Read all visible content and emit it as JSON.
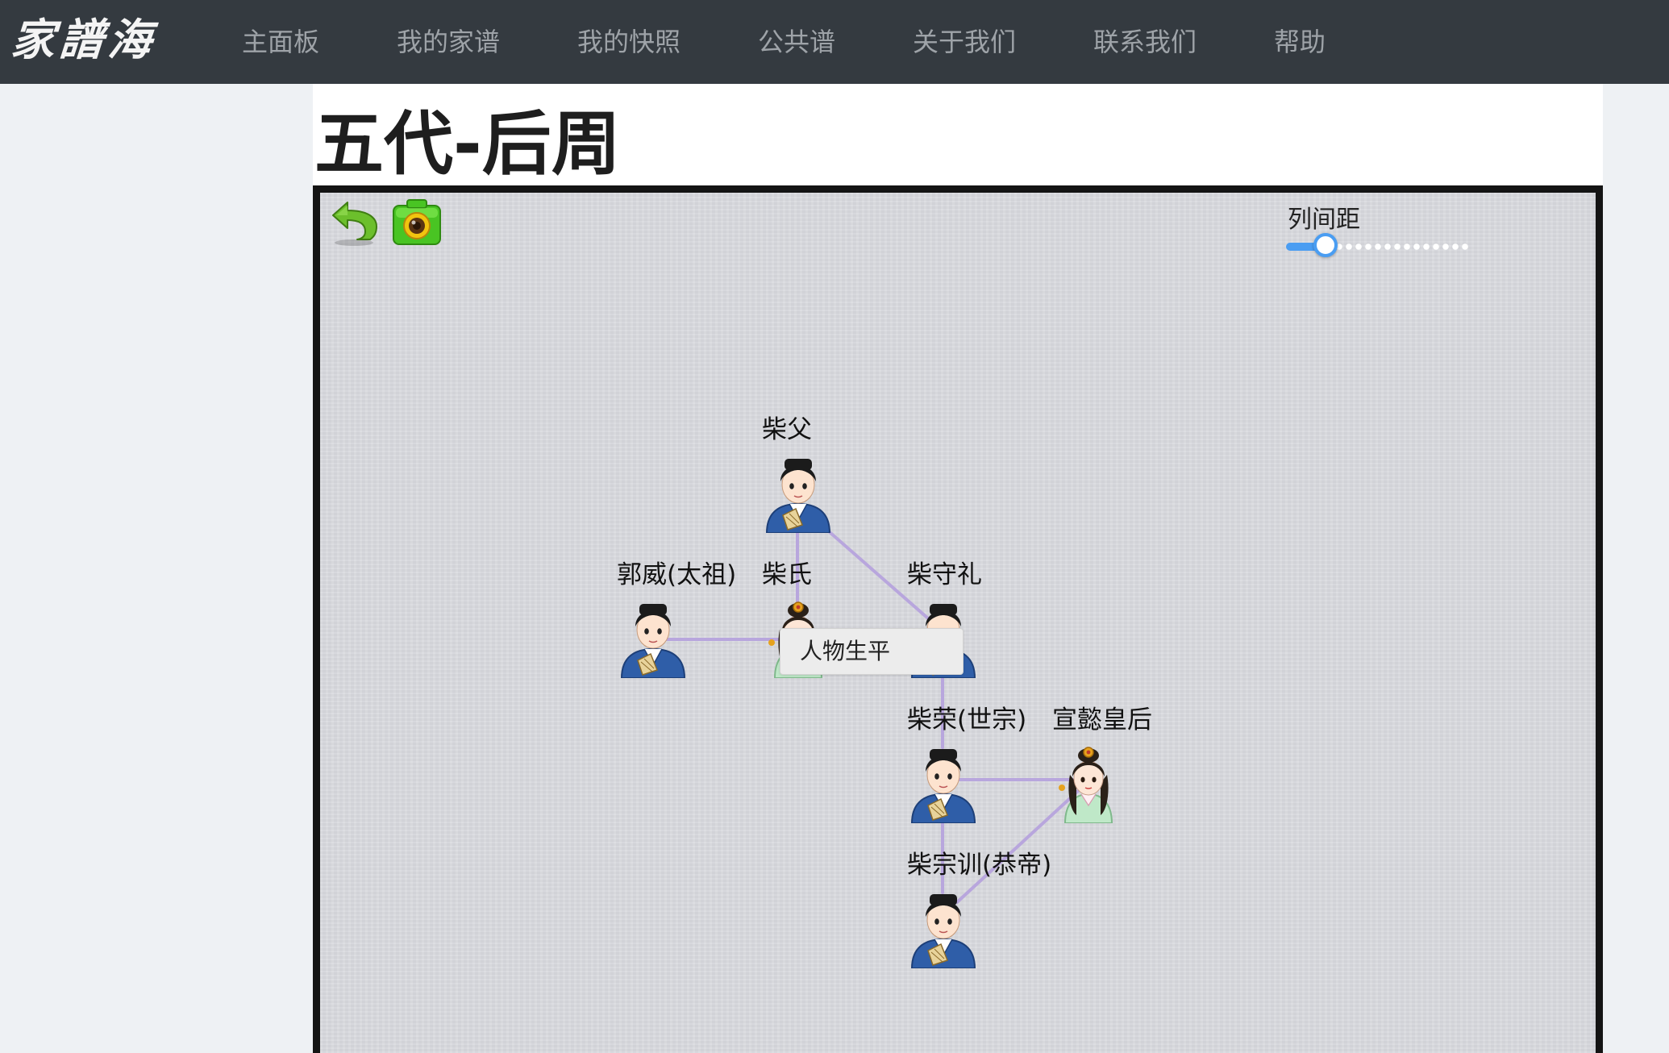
{
  "app": {
    "logo_text": "家譜海"
  },
  "nav": {
    "items": [
      {
        "label": "主面板"
      },
      {
        "label": "我的家谱"
      },
      {
        "label": "我的快照"
      },
      {
        "label": "公共谱"
      },
      {
        "label": "关于我们"
      },
      {
        "label": "联系我们"
      },
      {
        "label": "帮助"
      }
    ]
  },
  "page": {
    "title": "五代-后周"
  },
  "toolbar": {
    "back_icon": "back-arrow-icon",
    "snapshot_icon": "camera-icon",
    "column_spacing_label": "列间距",
    "column_spacing_value": 0.17
  },
  "tree": {
    "persons": [
      {
        "name": "柴父",
        "gender": "male"
      },
      {
        "name": "郭威(太祖)",
        "gender": "male"
      },
      {
        "name": "柴氏",
        "gender": "female"
      },
      {
        "name": "柴守礼",
        "gender": "male"
      },
      {
        "name": "柴荣(世宗)",
        "gender": "male"
      },
      {
        "name": "宣懿皇后",
        "gender": "female"
      },
      {
        "name": "柴宗训(恭帝)",
        "gender": "male"
      }
    ],
    "line_color": "#b8a6dd"
  },
  "context_menu": {
    "items": [
      {
        "label": "人物生平"
      }
    ]
  },
  "colors": {
    "navbar": "#343a40",
    "nav_text": "#9ea3a8",
    "slider_accent": "#4a9df2",
    "male_robe": "#2f5ea8",
    "female_dress": "#bfe8c8"
  }
}
